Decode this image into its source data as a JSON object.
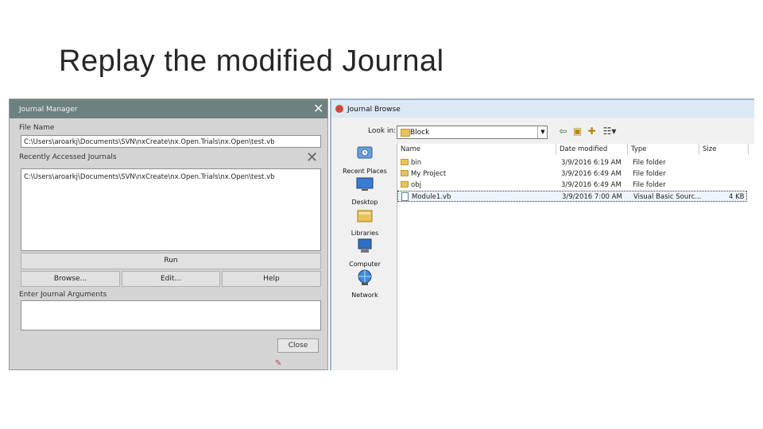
{
  "slide": {
    "title": "Replay the modified Journal"
  },
  "journal_manager": {
    "title": "Journal Manager",
    "file_name_label": "File Name",
    "file_name_value": "C:\\Users\\aroarkj\\Documents\\SVN\\nxCreate\\nx.Open.Trials\\nx.Open\\test.vb",
    "recent_label": "Recently Accessed Journals",
    "recent_items": [
      "C:\\Users\\aroarkj\\Documents\\SVN\\nxCreate\\nx.Open.Trials\\nx.Open\\test.vb"
    ],
    "run_label": "Run",
    "browse_label": "Browse...",
    "edit_label": "Edit...",
    "help_label": "Help",
    "args_label": "Enter Journal Arguments",
    "args_value": "",
    "close_label": "Close"
  },
  "journal_browse": {
    "title": "Journal Browse",
    "look_in_label": "Look in:",
    "look_in_value": "Block",
    "places": [
      {
        "label": "Recent Places",
        "icon": "recent-places-icon"
      },
      {
        "label": "Desktop",
        "icon": "desktop-icon"
      },
      {
        "label": "Libraries",
        "icon": "libraries-icon"
      },
      {
        "label": "Computer",
        "icon": "computer-icon"
      },
      {
        "label": "Network",
        "icon": "network-icon"
      }
    ],
    "columns": [
      "Name",
      "Date modified",
      "Type",
      "Size"
    ],
    "files": [
      {
        "name": "bin",
        "date": "3/9/2016 6:19 AM",
        "type": "File folder",
        "size": "",
        "icon": "folder-icon"
      },
      {
        "name": "My Project",
        "date": "3/9/2016 6:49 AM",
        "type": "File folder",
        "size": "",
        "icon": "folder-icon"
      },
      {
        "name": "obj",
        "date": "3/9/2016 6:49 AM",
        "type": "File folder",
        "size": "",
        "icon": "folder-icon"
      },
      {
        "name": "Module1.vb",
        "date": "3/9/2016 7:00 AM",
        "type": "Visual Basic Sourc...",
        "size": "4 KB",
        "icon": "vb-file-icon",
        "selected": true
      }
    ]
  },
  "colors": {
    "jm_titlebar": "#6e8181",
    "jb_titlebar": "#dce8f4",
    "folder": "#e8c25a"
  }
}
